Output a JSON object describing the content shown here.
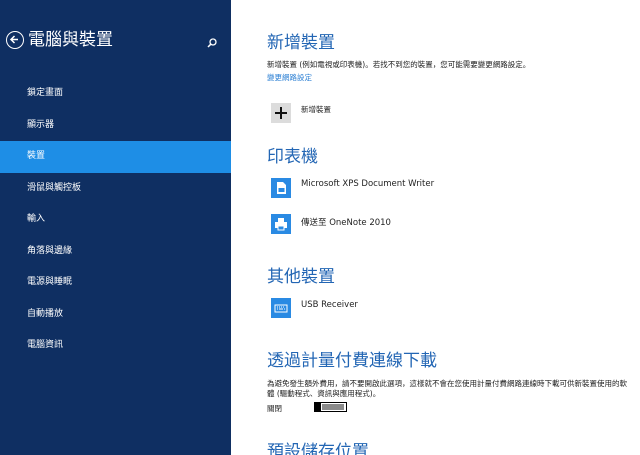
{
  "sidebar": {
    "title": "電腦與裝置",
    "items": [
      {
        "label": "鎖定畫面"
      },
      {
        "label": "顯示器"
      },
      {
        "label": "裝置",
        "active": true
      },
      {
        "label": "滑鼠與觸控板"
      },
      {
        "label": "輸入"
      },
      {
        "label": "角落與邊緣"
      },
      {
        "label": "電源與睡眠"
      },
      {
        "label": "自動播放"
      },
      {
        "label": "電腦資訊"
      }
    ]
  },
  "main": {
    "add_devices": {
      "title": "新增裝置",
      "description": "新增裝置 (例如電視或印表機)。若找不到您的裝置，您可能需要變更網路設定。",
      "link": "變更網路設定",
      "button_label": "新增裝置"
    },
    "printers": {
      "title": "印表機",
      "devices": [
        {
          "label": "Microsoft XPS Document Writer",
          "icon": "document-printer-icon"
        },
        {
          "label": "傳送至 OneNote 2010",
          "icon": "printer-icon"
        }
      ]
    },
    "other_devices": {
      "title": "其他裝置",
      "devices": [
        {
          "label": "USB Receiver",
          "icon": "keyboard-icon"
        }
      ]
    },
    "metered": {
      "title": "透過計量付費連線下載",
      "description": "為避免發生額外費用，請不要開啟此選項，這樣就不會在您使用計量付費網路連線時下載可供新裝置使用的軟體 (驅動程式、資訊與應用程式)。",
      "toggle_label": "關閉",
      "toggle_on": false
    },
    "default_storage": {
      "title": "預設儲存位置"
    }
  },
  "colors": {
    "sidebar_bg": "#0f2f62",
    "active_item": "#1e8ee6",
    "accent_title": "#2366b4",
    "link": "#2d80d4",
    "device_tile": "#2a8ae3"
  }
}
